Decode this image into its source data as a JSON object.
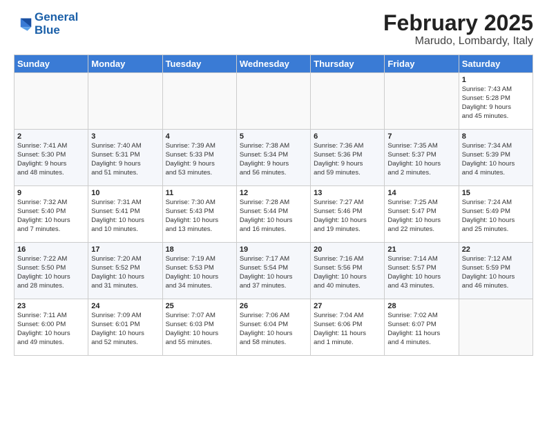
{
  "header": {
    "logo_line1": "General",
    "logo_line2": "Blue",
    "main_title": "February 2025",
    "sub_title": "Marudo, Lombardy, Italy"
  },
  "weekdays": [
    "Sunday",
    "Monday",
    "Tuesday",
    "Wednesday",
    "Thursday",
    "Friday",
    "Saturday"
  ],
  "weeks": [
    [
      {
        "day": "",
        "info": ""
      },
      {
        "day": "",
        "info": ""
      },
      {
        "day": "",
        "info": ""
      },
      {
        "day": "",
        "info": ""
      },
      {
        "day": "",
        "info": ""
      },
      {
        "day": "",
        "info": ""
      },
      {
        "day": "1",
        "info": "Sunrise: 7:43 AM\nSunset: 5:28 PM\nDaylight: 9 hours\nand 45 minutes."
      }
    ],
    [
      {
        "day": "2",
        "info": "Sunrise: 7:41 AM\nSunset: 5:30 PM\nDaylight: 9 hours\nand 48 minutes."
      },
      {
        "day": "3",
        "info": "Sunrise: 7:40 AM\nSunset: 5:31 PM\nDaylight: 9 hours\nand 51 minutes."
      },
      {
        "day": "4",
        "info": "Sunrise: 7:39 AM\nSunset: 5:33 PM\nDaylight: 9 hours\nand 53 minutes."
      },
      {
        "day": "5",
        "info": "Sunrise: 7:38 AM\nSunset: 5:34 PM\nDaylight: 9 hours\nand 56 minutes."
      },
      {
        "day": "6",
        "info": "Sunrise: 7:36 AM\nSunset: 5:36 PM\nDaylight: 9 hours\nand 59 minutes."
      },
      {
        "day": "7",
        "info": "Sunrise: 7:35 AM\nSunset: 5:37 PM\nDaylight: 10 hours\nand 2 minutes."
      },
      {
        "day": "8",
        "info": "Sunrise: 7:34 AM\nSunset: 5:39 PM\nDaylight: 10 hours\nand 4 minutes."
      }
    ],
    [
      {
        "day": "9",
        "info": "Sunrise: 7:32 AM\nSunset: 5:40 PM\nDaylight: 10 hours\nand 7 minutes."
      },
      {
        "day": "10",
        "info": "Sunrise: 7:31 AM\nSunset: 5:41 PM\nDaylight: 10 hours\nand 10 minutes."
      },
      {
        "day": "11",
        "info": "Sunrise: 7:30 AM\nSunset: 5:43 PM\nDaylight: 10 hours\nand 13 minutes."
      },
      {
        "day": "12",
        "info": "Sunrise: 7:28 AM\nSunset: 5:44 PM\nDaylight: 10 hours\nand 16 minutes."
      },
      {
        "day": "13",
        "info": "Sunrise: 7:27 AM\nSunset: 5:46 PM\nDaylight: 10 hours\nand 19 minutes."
      },
      {
        "day": "14",
        "info": "Sunrise: 7:25 AM\nSunset: 5:47 PM\nDaylight: 10 hours\nand 22 minutes."
      },
      {
        "day": "15",
        "info": "Sunrise: 7:24 AM\nSunset: 5:49 PM\nDaylight: 10 hours\nand 25 minutes."
      }
    ],
    [
      {
        "day": "16",
        "info": "Sunrise: 7:22 AM\nSunset: 5:50 PM\nDaylight: 10 hours\nand 28 minutes."
      },
      {
        "day": "17",
        "info": "Sunrise: 7:20 AM\nSunset: 5:52 PM\nDaylight: 10 hours\nand 31 minutes."
      },
      {
        "day": "18",
        "info": "Sunrise: 7:19 AM\nSunset: 5:53 PM\nDaylight: 10 hours\nand 34 minutes."
      },
      {
        "day": "19",
        "info": "Sunrise: 7:17 AM\nSunset: 5:54 PM\nDaylight: 10 hours\nand 37 minutes."
      },
      {
        "day": "20",
        "info": "Sunrise: 7:16 AM\nSunset: 5:56 PM\nDaylight: 10 hours\nand 40 minutes."
      },
      {
        "day": "21",
        "info": "Sunrise: 7:14 AM\nSunset: 5:57 PM\nDaylight: 10 hours\nand 43 minutes."
      },
      {
        "day": "22",
        "info": "Sunrise: 7:12 AM\nSunset: 5:59 PM\nDaylight: 10 hours\nand 46 minutes."
      }
    ],
    [
      {
        "day": "23",
        "info": "Sunrise: 7:11 AM\nSunset: 6:00 PM\nDaylight: 10 hours\nand 49 minutes."
      },
      {
        "day": "24",
        "info": "Sunrise: 7:09 AM\nSunset: 6:01 PM\nDaylight: 10 hours\nand 52 minutes."
      },
      {
        "day": "25",
        "info": "Sunrise: 7:07 AM\nSunset: 6:03 PM\nDaylight: 10 hours\nand 55 minutes."
      },
      {
        "day": "26",
        "info": "Sunrise: 7:06 AM\nSunset: 6:04 PM\nDaylight: 10 hours\nand 58 minutes."
      },
      {
        "day": "27",
        "info": "Sunrise: 7:04 AM\nSunset: 6:06 PM\nDaylight: 11 hours\nand 1 minute."
      },
      {
        "day": "28",
        "info": "Sunrise: 7:02 AM\nSunset: 6:07 PM\nDaylight: 11 hours\nand 4 minutes."
      },
      {
        "day": "",
        "info": ""
      }
    ]
  ]
}
